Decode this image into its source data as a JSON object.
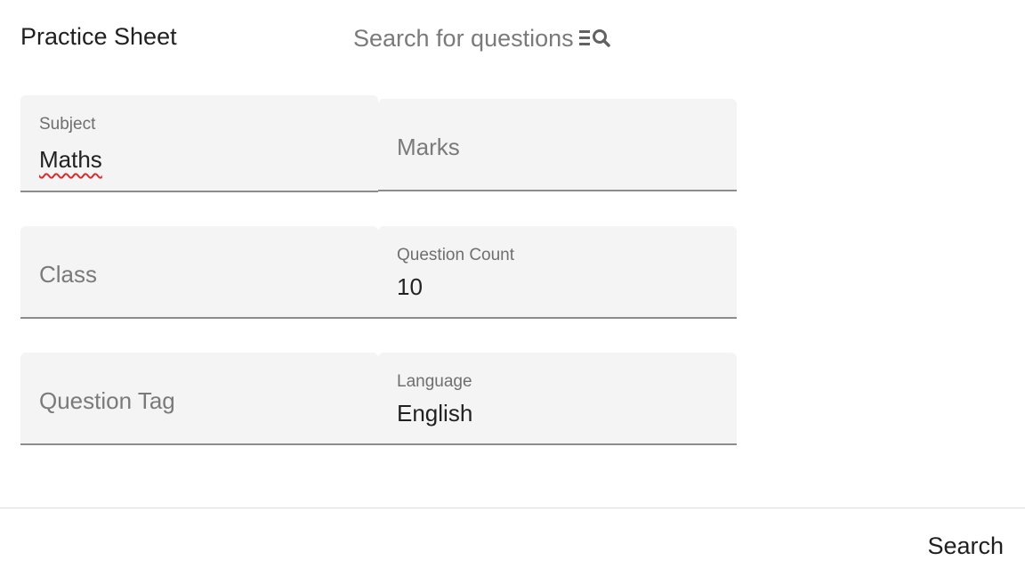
{
  "header": {
    "title": "Practice Sheet",
    "search_link_label": "Search for questions",
    "search_link_icon": "manage-search-icon"
  },
  "form": {
    "subject": {
      "label": "Subject",
      "value": "Maths"
    },
    "marks": {
      "placeholder": "Marks"
    },
    "class": {
      "placeholder": "Class"
    },
    "question_count": {
      "label": "Question Count",
      "value": "10"
    },
    "question_tag": {
      "placeholder": "Question Tag"
    },
    "language": {
      "label": "Language",
      "value": "English"
    }
  },
  "footer": {
    "search_label": "Search"
  },
  "colors": {
    "field_background": "#f4f4f4",
    "field_underline": "#8c8c8c",
    "spellcheck_underline": "#d32f2f"
  }
}
